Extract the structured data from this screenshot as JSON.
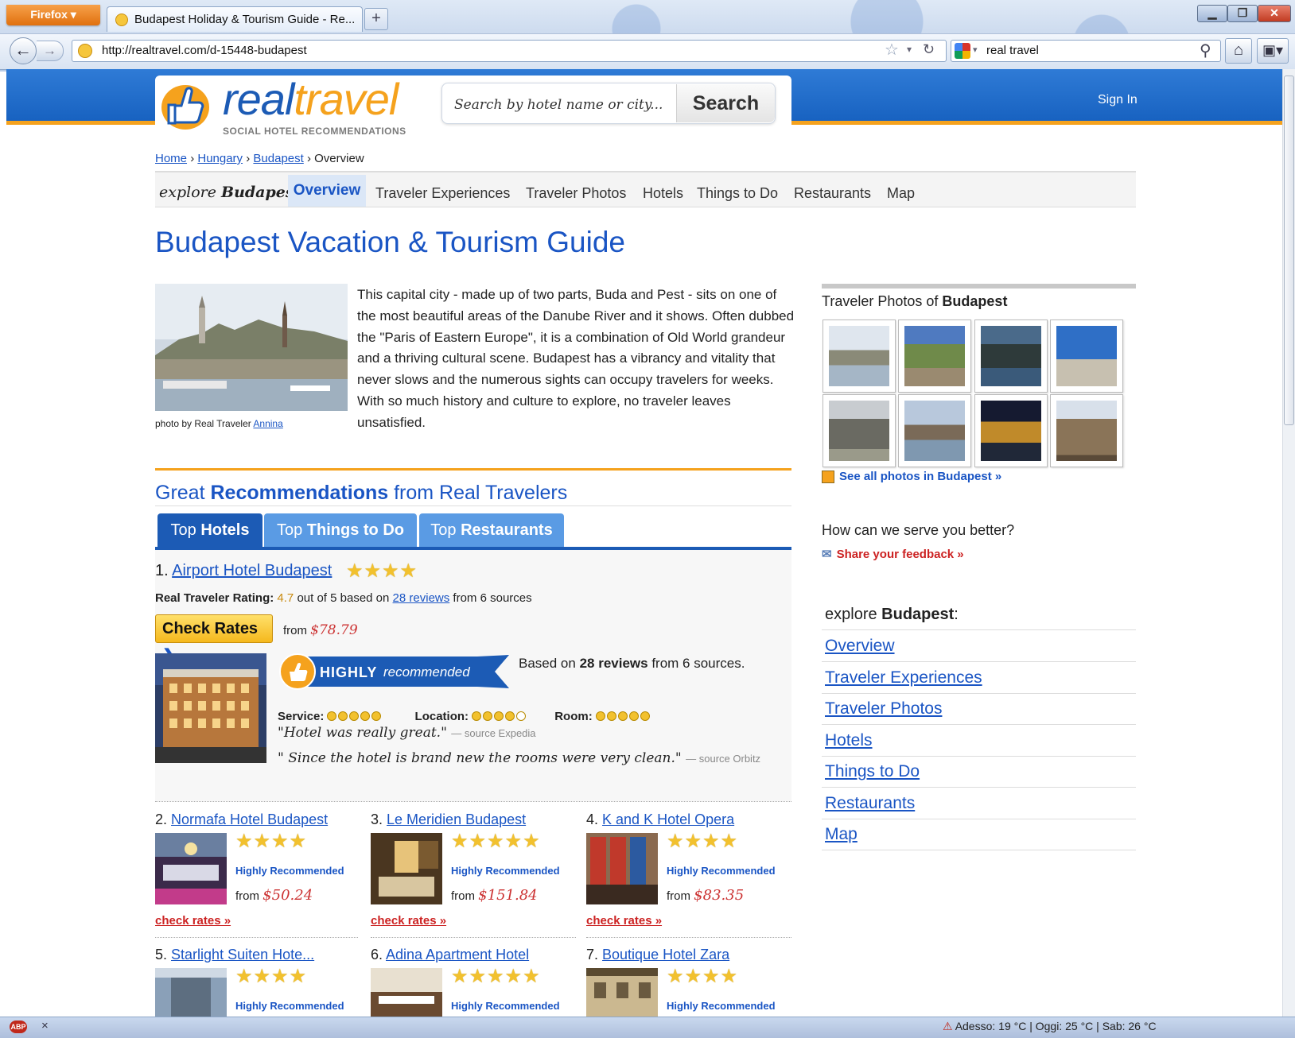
{
  "browser": {
    "menu_button": "Firefox ▾",
    "tab_title": "Budapest Holiday & Tourism Guide - Re...",
    "new_tab": "+",
    "url": "http://realtravel.com/d-15448-budapest",
    "search_query": "real travel",
    "window_buttons": {
      "minimize": "▁",
      "maximize": "❐",
      "close": "✕"
    }
  },
  "header": {
    "logo_real": "real",
    "logo_travel": "travel",
    "logo_tagline": "SOCIAL HOTEL RECOMMENDATIONS",
    "search_placeholder": "Search by hotel name or city...",
    "search_button": "Search",
    "sign_in": "Sign In"
  },
  "breadcrumb": {
    "items": [
      "Home",
      "Hungary",
      "Budapest"
    ],
    "current": "Overview",
    "separator": "›"
  },
  "explore_nav": {
    "label_prefix": "explore",
    "label_city": "Budapest:",
    "active": "Overview",
    "tabs": [
      "Traveler Experiences",
      "Traveler Photos",
      "Hotels",
      "Things to Do",
      "Restaurants",
      "Map"
    ]
  },
  "page_title": "Budapest Vacation & Tourism Guide",
  "intro": {
    "photo_credit_prefix": "photo by Real Traveler",
    "photo_credit_name": "Annina",
    "text": "This capital city - made up of two parts, Buda and Pest - sits on one of the most beautiful areas of the Danube River and it shows. Often dubbed the \"Paris of Eastern Europe\", it is a combination of Old World grandeur and a thriving cultural scene. Budapest has a vibrancy and vitality that never slows and the numerous sights can occupy travelers for weeks. With so much history and culture to explore, no traveler leaves unsatisfied."
  },
  "recommendations": {
    "title_pre": "Great",
    "title_bold": "Recommendations",
    "title_post": "from Real Travelers",
    "tabs": [
      {
        "pre": "Top",
        "bold": "Hotels"
      },
      {
        "pre": "Top",
        "bold": "Things to Do"
      },
      {
        "pre": "Top",
        "bold": "Restaurants"
      }
    ],
    "featured": {
      "rank": "1.",
      "name": "Airport Hotel Budapest",
      "stars": "★★★★",
      "rating_label": "Real Traveler Rating:",
      "rating_value": "4.7",
      "rating_mid": "out of 5 based on",
      "reviews_link": "28 reviews",
      "rating_post": "from 6 sources",
      "check_rates": "Check Rates",
      "from_label": "from",
      "price": "$78.79",
      "badge_bold": "HIGHLY",
      "badge_italic": "recommended",
      "based_pre": "Based on",
      "based_bold": "28 reviews",
      "based_post": "from 6 sources.",
      "score_labels": [
        "Service:",
        "Location:",
        "Room:"
      ],
      "score_values": [
        5,
        4.5,
        5
      ],
      "quotes": [
        {
          "text": "\"Hotel was really great.\"",
          "source": "— source Expedia"
        },
        {
          "text": "\" Since the hotel is brand new the rooms were very clean.\"",
          "source": "— source Orbitz"
        }
      ]
    },
    "hotels": [
      {
        "rank": "2.",
        "name": "Normafa Hotel Budapest",
        "stars": "★★★★",
        "rec": "Highly Recommended",
        "from": "from",
        "price": "$50.24",
        "check": "check rates »"
      },
      {
        "rank": "3.",
        "name": "Le Meridien Budapest",
        "stars": "★★★★★",
        "rec": "Highly Recommended",
        "from": "from",
        "price": "$151.84",
        "check": "check rates »"
      },
      {
        "rank": "4.",
        "name": "K and K Hotel Opera",
        "stars": "★★★★",
        "rec": "Highly Recommended",
        "from": "from",
        "price": "$83.35",
        "check": "check rates »"
      },
      {
        "rank": "5.",
        "name": "Starlight Suiten Hote...",
        "stars": "★★★★",
        "rec": "Highly Recommended"
      },
      {
        "rank": "6.",
        "name": "Adina Apartment Hotel",
        "stars": "★★★★★",
        "rec": "Highly Recommended"
      },
      {
        "rank": "7.",
        "name": "Boutique Hotel Zara",
        "stars": "★★★★",
        "rec": "Highly Recommended"
      }
    ]
  },
  "sidebar": {
    "photos_title_pre": "Traveler Photos of",
    "photos_title_bold": "Budapest",
    "see_all": "See all photos in Budapest »",
    "serve": "How can we serve you better?",
    "feedback": "Share your feedback »",
    "explore_pre": "explore",
    "explore_bold": "Budapest",
    "explore_post": ":",
    "links": [
      "Overview",
      "Traveler Experiences",
      "Traveler Photos",
      "Hotels",
      "Things to Do",
      "Restaurants",
      "Map"
    ]
  },
  "status_bar": {
    "adblock": "ABP",
    "close": "×",
    "weather": "Adesso: 19 °C  |  Oggi: 25 °C  |  Sab: 26 °C"
  }
}
